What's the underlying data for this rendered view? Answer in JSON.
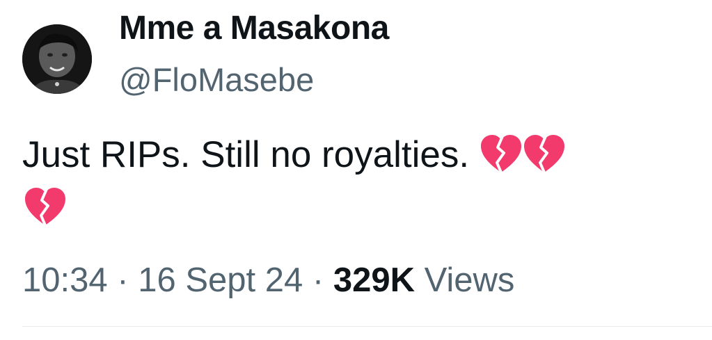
{
  "tweet": {
    "author": {
      "display_name": "Mme a Masakona",
      "handle": "@FloMasebe",
      "avatar": "profile-photo"
    },
    "text": "Just RIPs. Still no royalties.",
    "emojis": [
      "broken-heart",
      "broken-heart",
      "broken-heart"
    ],
    "meta": {
      "time": "10:34",
      "separator": "·",
      "date": "16 Sept 24",
      "views_count": "329K",
      "views_label": "Views"
    }
  },
  "colors": {
    "text_primary": "#0f1419",
    "text_secondary": "#536471",
    "divider": "#e6ecf0",
    "emoji_heart": "#f23a6d"
  }
}
